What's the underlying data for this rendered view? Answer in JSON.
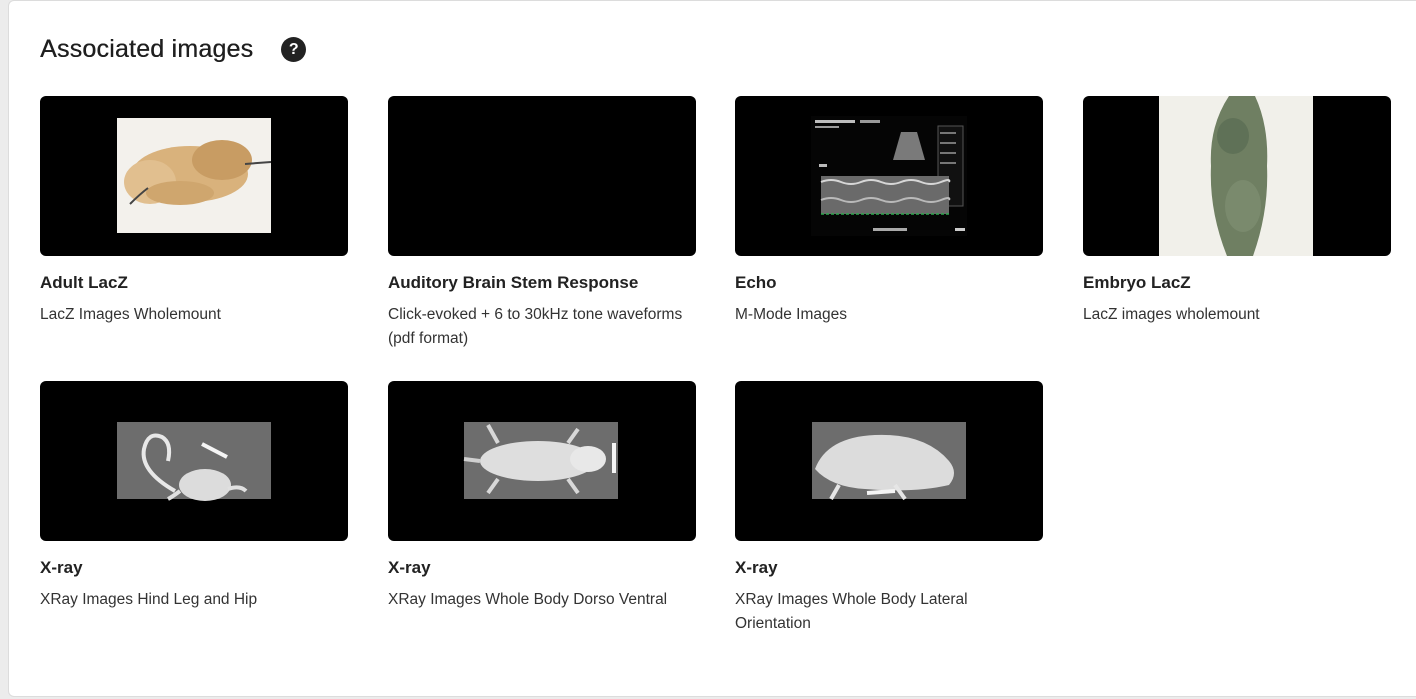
{
  "section": {
    "title": "Associated images",
    "help_symbol": "?"
  },
  "cards": [
    {
      "title": "Adult LacZ",
      "subtitle": "LacZ Images Wholemount",
      "image": "adult-lacz-brain-thumbnail"
    },
    {
      "title": "Auditory Brain Stem Response",
      "subtitle": "Click-evoked + 6 to 30kHz tone waveforms (pdf format)",
      "image": "blank-black-thumbnail"
    },
    {
      "title": "Echo",
      "subtitle": "M-Mode Images",
      "image": "echo-mmode-thumbnail"
    },
    {
      "title": "Embryo LacZ",
      "subtitle": "LacZ images wholemount",
      "image": "embryo-lacz-thumbnail"
    },
    {
      "title": "X-ray",
      "subtitle": "XRay Images Hind Leg and Hip",
      "image": "xray-hind-leg-thumbnail"
    },
    {
      "title": "X-ray",
      "subtitle": "XRay Images Whole Body Dorso Ventral",
      "image": "xray-dorso-ventral-thumbnail"
    },
    {
      "title": "X-ray",
      "subtitle": "XRay Images Whole Body Lateral Orientation",
      "image": "xray-lateral-thumbnail"
    }
  ],
  "colors": {
    "thumbnail_background": "#000000",
    "help_icon_background": "#222222",
    "xray_background": "#6d6d6d"
  }
}
